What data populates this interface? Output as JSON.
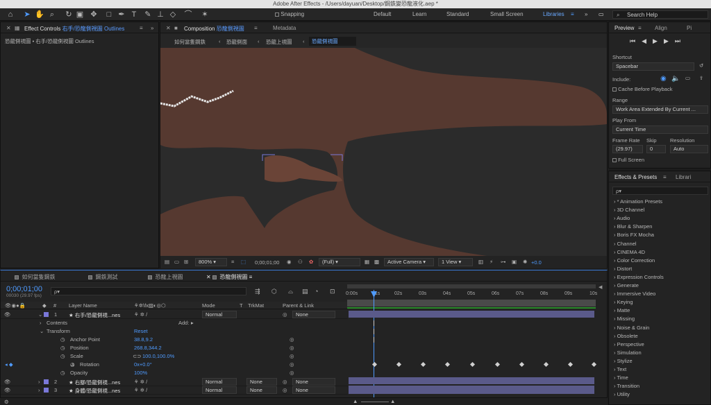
{
  "app": {
    "title": "Adobe After Effects - /Users/dayuan/Desktop/鋼鉄變恐龍液化.aep *"
  },
  "toolbar": {
    "snapping": "Snapping",
    "workspaces": [
      "Default",
      "Learn",
      "Standard",
      "Small Screen",
      "Libraries"
    ],
    "active_workspace": "Libraries",
    "search": "Search Help"
  },
  "effect_controls": {
    "tab": "Effect Controls",
    "tab_target": "右手/恐龍側視圖 Outlines",
    "subtitle": "恐龍側視圖 • 右手/恐龍側視圖 Outlines"
  },
  "composition": {
    "tab": "Composition",
    "tab_name": "恐龍側視圖",
    "metadata": "Metadata",
    "breadcrumbs": [
      "如何當隻鋼鉄",
      "恐龍側面",
      "恐龍上視圖",
      "恐龍側視圖"
    ],
    "zoom": "800%",
    "timecode": "0;00;01;00",
    "quality": "(Full)",
    "camera": "Active Camera",
    "views": "1 View",
    "exposure": "+0.0"
  },
  "preview": {
    "tabs": [
      "Preview",
      "Align",
      "Pi"
    ],
    "shortcut_label": "Shortcut",
    "shortcut": "Spacebar",
    "include_label": "Include:",
    "cache_label": "Cache Before Playback",
    "range_label": "Range",
    "range": "Work Area Extended By Current ...",
    "playfrom_label": "Play From",
    "playfrom": "Current Time",
    "framerate_label": "Frame Rate",
    "skip_label": "Skip",
    "resolution_label": "Resolution",
    "framerate": "(29.97)",
    "skip": "0",
    "resolution": "Auto",
    "fullscreen_label": "Full Screen"
  },
  "effects": {
    "tabs": [
      "Effects & Presets",
      "Librari"
    ],
    "search_placeholder": "ρ▾",
    "items": [
      "* Animation Presets",
      "3D Channel",
      "Audio",
      "Blur & Sharpen",
      "Boris FX Mocha",
      "Channel",
      "CINEMA 4D",
      "Color Correction",
      "Distort",
      "Expression Controls",
      "Generate",
      "Immersive Video",
      "Keying",
      "Matte",
      "Missing",
      "Noise & Grain",
      "Obsolete",
      "Perspective",
      "Simulation",
      "Stylize",
      "Text",
      "Time",
      "Transition",
      "Utility"
    ]
  },
  "timeline": {
    "tabs": [
      "如何當隻鋼鉄",
      "鋼鉄測試",
      "恐龍上視圖",
      "恐龍側視圖"
    ],
    "timecode": "0;00;01;00",
    "fps": "00030 (29.97 fps)",
    "search": "ρ▾",
    "headers": {
      "num": "#",
      "layer": "Layer Name",
      "mode": "Mode",
      "t": "T",
      "trkmat": "TrkMat",
      "parent": "Parent & Link"
    },
    "ruler": [
      "0:00s",
      "01s",
      "02s",
      "03s",
      "04s",
      "05s",
      "06s",
      "07s",
      "08s",
      "09s",
      "10s"
    ],
    "layers": [
      {
        "num": "1",
        "name": "★ 右手/恐龍側視...nes",
        "mode": "Normal",
        "trkmat": "",
        "parent": "None"
      },
      {
        "num": "2",
        "name": "★ 右腳/恐龍側視...nes",
        "mode": "Normal",
        "trkmat": "None",
        "parent": "None"
      },
      {
        "num": "3",
        "name": "★ 身體/恐龍側視...nes",
        "mode": "Normal",
        "trkmat": "None",
        "parent": "None"
      }
    ],
    "props": {
      "contents": "Contents",
      "add": "Add:",
      "transform": "Transform",
      "reset": "Reset",
      "anchor": "Anchor Point",
      "anchor_val": "38.8,9.2",
      "position": "Position",
      "position_val": "268.8,344.2",
      "scale": "Scale",
      "scale_val": "100.0,100.0%",
      "rotation": "Rotation",
      "rotation_val": "0x+0.0°",
      "opacity": "Opacity",
      "opacity_val": "100%"
    }
  },
  "colors": {
    "accent": "#4f9bff",
    "skin": "#5b3b31",
    "canvas": "#2b2b2b",
    "layer_bar": "#5a5a8a"
  }
}
